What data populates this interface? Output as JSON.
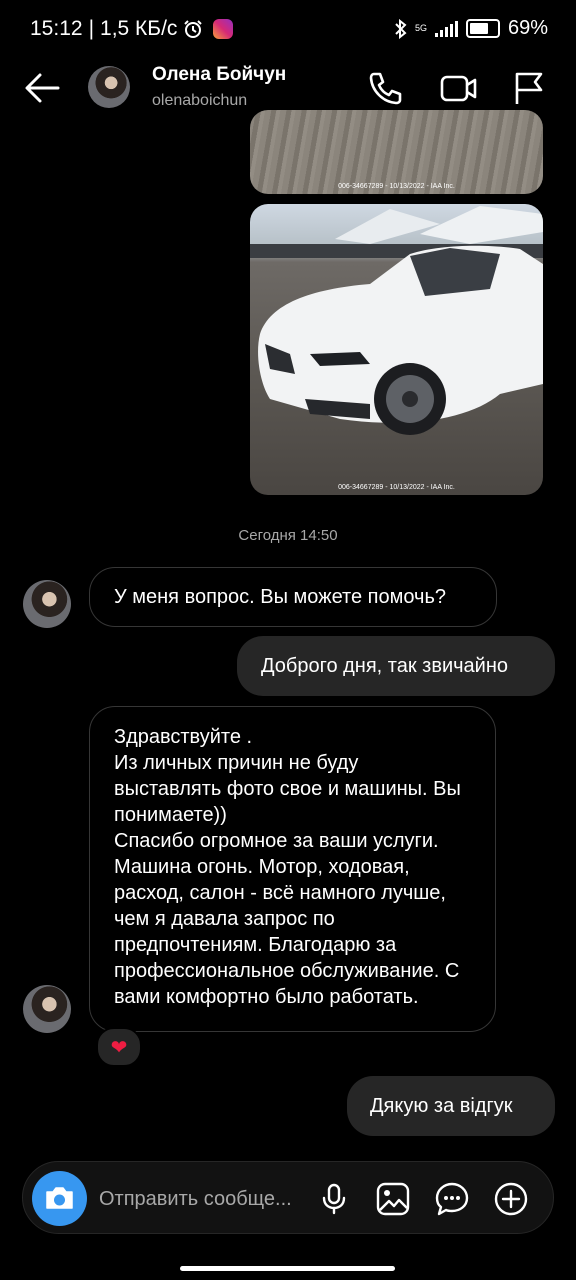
{
  "status_bar": {
    "time": "15:12",
    "speed": "1,5 КБ/с",
    "network": "5G",
    "battery": "69",
    "battery_fraction": 0.69
  },
  "header": {
    "contact_name": "Олена Бойчун",
    "contact_handle": "olenaboichun"
  },
  "media": {
    "photo_1_caption": "006-34667289 - 10/13/2022 - IAA Inc.",
    "photo_2_caption": "006-34667289 - 10/13/2022 - IAA Inc."
  },
  "conversation": {
    "timestamp": "Сегодня 14:50",
    "messages": [
      {
        "direction": "incoming",
        "text": "У меня вопрос. Вы можете помочь?"
      },
      {
        "direction": "outgoing",
        "text": "Доброго дня, так звичайно"
      },
      {
        "direction": "incoming",
        "text": "Здравствуйте .\nИз личных причин не буду выставлять фото свое и машины. Вы понимаете))\nСпасибо огромное за ваши услуги. Машина огонь. Мотор, ходовая, расход, салон - всё намного лучше, чем я давала запрос по предпочтениям. Благодарю за профессиональное обслуживание. С вами комфортно было работать.",
        "reaction": "❤"
      },
      {
        "direction": "outgoing",
        "text": "Дякую за відгук"
      }
    ]
  },
  "composer": {
    "placeholder": "Отправить сообще..."
  },
  "colors": {
    "accent": "#3797f0",
    "outgoing_bubble": "#262626",
    "reaction_heart": "#ee1d42"
  },
  "icons": [
    "back-arrow-icon",
    "phone-icon",
    "video-call-icon",
    "flag-icon",
    "camera-icon",
    "microphone-icon",
    "gallery-icon",
    "sticker-icon",
    "add-icon"
  ]
}
